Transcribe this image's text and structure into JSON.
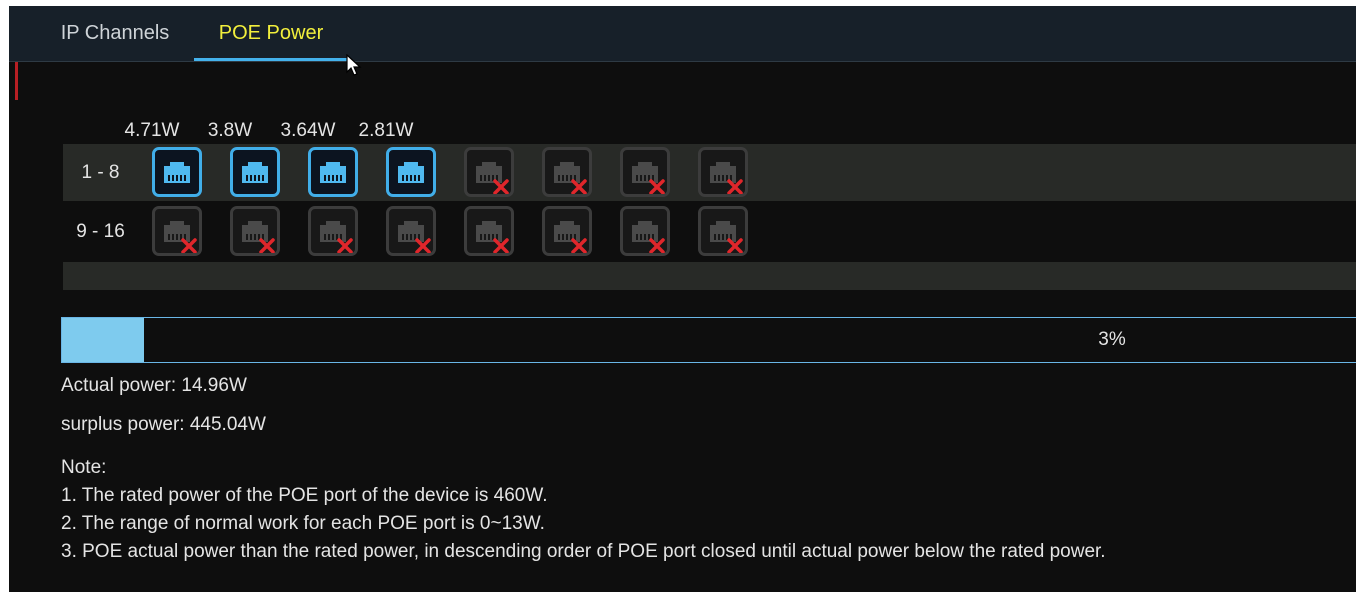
{
  "tabs": [
    {
      "label": "IP Channels",
      "active": false
    },
    {
      "label": "POE Power",
      "active": true
    }
  ],
  "colors": {
    "accent": "#44b2ec",
    "active_tab_text": "#f2ef3c",
    "port_on": "#41aee9",
    "port_off_x": "#e0262b",
    "progress_fill": "#7ecbee"
  },
  "ports": {
    "wattages": [
      "4.71W",
      "3.8W",
      "3.64W",
      "2.81W"
    ],
    "rows": [
      {
        "label": "1 - 8",
        "status": [
          "on",
          "on",
          "on",
          "on",
          "off",
          "off",
          "off",
          "off"
        ]
      },
      {
        "label": "9 - 16",
        "status": [
          "off",
          "off",
          "off",
          "off",
          "off",
          "off",
          "off",
          "off"
        ]
      }
    ],
    "icon_on": "ethernet-port-icon",
    "icon_off": "ethernet-port-disconnected-icon"
  },
  "power_usage": {
    "percent_label": "3%",
    "fraction": 0.03
  },
  "actual_power": "Actual power: 14.96W",
  "surplus_power": "surplus power: 445.04W",
  "note": {
    "title": "Note:",
    "lines": [
      "1. The rated power of the POE port of the device is 460W.",
      "2. The range of normal work for each POE port is 0~13W.",
      "3. POE actual power than the rated power, in descending order of POE port closed until actual power below the rated power."
    ]
  }
}
